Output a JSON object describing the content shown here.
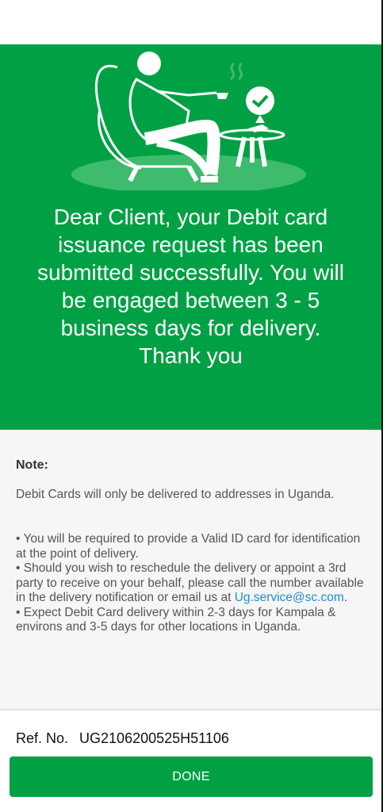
{
  "hero": {
    "illustration_icon": "person-relaxing-with-checkmark-illustration",
    "message": "Dear Client, your Debit card issuance request has been submitted successfully. You will be engaged between 3 - 5 business days for delivery. Thank you",
    "background_color": "#00a144"
  },
  "note": {
    "title": "Note:",
    "line": "Debit Cards will only be delivered to addresses in Uganda.",
    "bullet1": "•   You will be required to provide a Valid ID card for identification at the point of delivery.",
    "bullet2_text": "•   Should you wish to reschedule the delivery or appoint a 3rd party to receive on your behalf, please call the number available in the delivery notification or email us at",
    "bullet2_email": "Ug.service@sc.com",
    "bullet2_end": ".",
    "bullet3": "•   Expect Debit Card delivery within 2-3 days for  Kampala & environs and 3-5 days for other locations in Uganda."
  },
  "reference": {
    "label": "Ref. No.",
    "value": "UG2106200525H51106"
  },
  "done_button": {
    "label": "DONE"
  },
  "colors": {
    "accent": "#00a144",
    "link": "#1a8fd1"
  }
}
